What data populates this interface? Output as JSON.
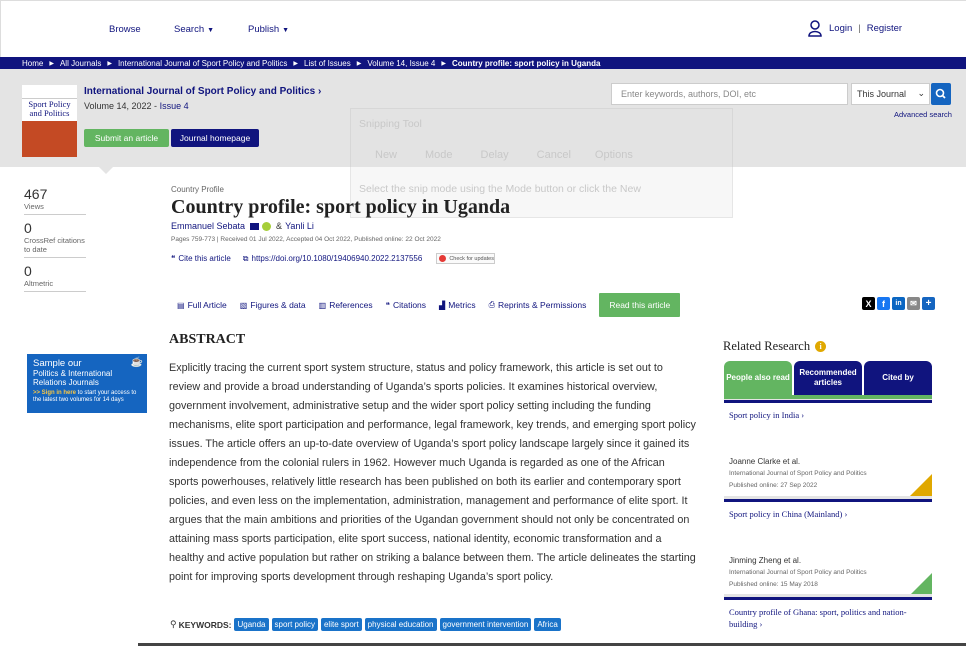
{
  "nav": {
    "browse": "Browse",
    "search": "Search",
    "publish": "Publish",
    "login": "Login",
    "sep": "|",
    "register": "Register"
  },
  "breadcrumb": [
    "Home",
    "All Journals",
    "International Journal of Sport Policy and Politics",
    "List of Issues",
    "Volume 14, Issue 4",
    "Country profile: sport policy in Uganda"
  ],
  "journal": {
    "cover_title": "Sport Policy and Politics",
    "title": "International Journal of Sport Policy and Politics",
    "title_arrow": "›",
    "volume": "Volume 14, 2022 - ",
    "issue": "Issue 4",
    "submit": "Submit an article",
    "homepage": "Journal homepage",
    "search_placeholder": "Enter keywords, authors, DOI, etc",
    "scope": "This Journal",
    "advanced": "Advanced search"
  },
  "snipping": {
    "title": "Snipping Tool",
    "new": "New",
    "mode": "Mode",
    "delay": "Delay",
    "cancel": "Cancel",
    "options": "Options",
    "hint": "Select the snip mode using the Mode button or click the New"
  },
  "metrics": [
    {
      "value": "467",
      "label": "Views"
    },
    {
      "value": "0",
      "label": "CrossRef citations to date"
    },
    {
      "value": "0",
      "label": "Altmetric"
    }
  ],
  "article": {
    "type": "Country Profile",
    "title": "Country profile: sport policy in Uganda",
    "author1": "Emmanuel Sebata",
    "amp": "&",
    "author2": "Yanli Li",
    "pages": "Pages 759-773 | Received 01 Jul 2022, Accepted 04 Oct 2022, Published online: 22 Oct 2022",
    "cite": "Cite this article",
    "doi": "https://doi.org/10.1080/19406940.2022.2137556",
    "check": "Check for updates"
  },
  "tabs": [
    "Full Article",
    "Figures & data",
    "References",
    "Citations",
    "Metrics",
    "Reprints & Permissions"
  ],
  "read_button": "Read this article",
  "sample": {
    "line1": "Sample our",
    "line2": "Politics & International Relations Journals",
    "signin": ">> Sign in here",
    "rest": " to start your access to the latest two volumes for 14 days"
  },
  "abstract": {
    "heading": "ABSTRACT",
    "text": "Explicitly tracing the current sport system structure, status and policy framework, this article is set out to review and provide a broad understanding of Uganda’s sports policies. It examines historical overview, government involvement, administrative setup and the wider sport policy setting including the funding mechanisms, elite sport participation and performance, legal framework, key trends, and emerging sport policy issues. The article offers an up-to-date overview of Uganda’s sport policy landscape largely since it gained its independence from the colonial rulers in 1962. However much Uganda is regarded as one of the African sports powerhouses, relatively little research has been published on both its earlier and contemporary sport policies, and even less on the implementation, administration, management and performance of elite sport. It argues that the main ambitions and priorities of the Ugandan government should not only be concentrated on attaining mass sports participation, elite sport success, national identity, economic transformation and a healthy and active population but rather on striking a balance between them. The article delineates the starting point for improving sports development through reshaping Uganda’s sport policy."
  },
  "keywords": {
    "label": "KEYWORDS:",
    "items": [
      "Uganda",
      "sport policy",
      "elite sport",
      "physical education",
      "government intervention",
      "Africa"
    ]
  },
  "related": {
    "heading": "Related Research",
    "tabs": [
      "People also read",
      "Recommended articles",
      "Cited by"
    ],
    "items": [
      {
        "title": "Sport policy in India",
        "author": "Joanne Clarke et al.",
        "journal": "International Journal of Sport Policy and Politics",
        "date": "Published online: 27 Sep 2022"
      },
      {
        "title": "Sport policy in China (Mainland)",
        "author": "Jinming Zheng et al.",
        "journal": "International Journal of Sport Policy and Politics",
        "date": "Published online: 15 May 2018"
      },
      {
        "title": "Country profile of Ghana: sport, politics and nation-building"
      }
    ]
  },
  "colors": {
    "brand": "#10147e",
    "green": "#63b561",
    "accent": "#1565c0",
    "gold": "#e0a800"
  }
}
